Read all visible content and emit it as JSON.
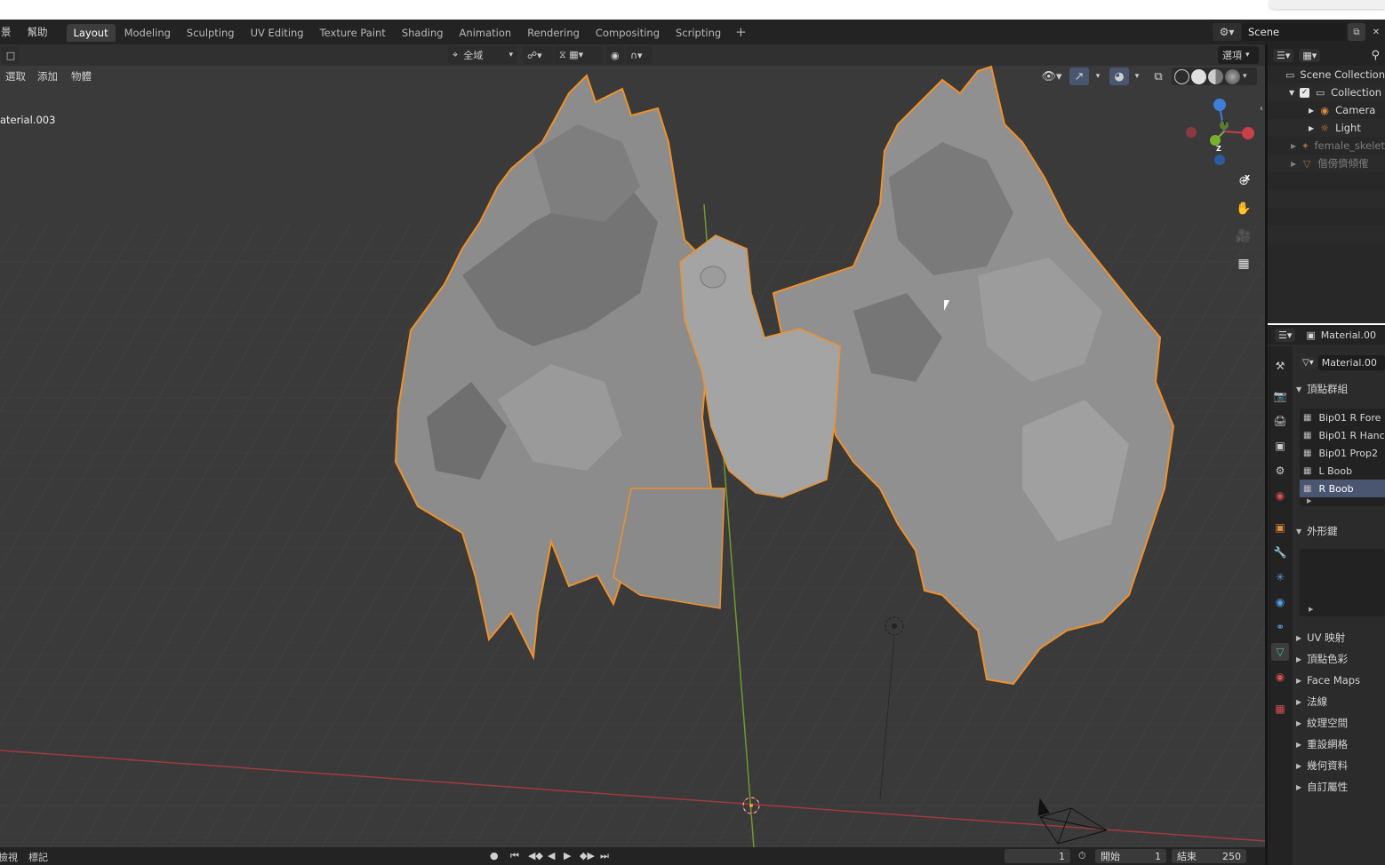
{
  "menu": {
    "partial_left": "景",
    "help": "幫助"
  },
  "workspaces": [
    "Layout",
    "Modeling",
    "Sculpting",
    "UV Editing",
    "Texture Paint",
    "Shading",
    "Animation",
    "Rendering",
    "Compositing",
    "Scripting"
  ],
  "workspace_add": "+",
  "scene": {
    "name": "Scene"
  },
  "viewport": {
    "orientation": "全域",
    "options": "選項",
    "menu_select": "選取",
    "menu_add": "添加",
    "menu_object": "物體",
    "object_label": "aterial.003",
    "gizmo_x": "X",
    "gizmo_y": "Y",
    "gizmo_z": "Z"
  },
  "timeline": {
    "view": "檢視",
    "marker": "標記",
    "current_frame": "1",
    "start_label": "開始",
    "start_value": "1",
    "end_label": "結束",
    "end_value": "250"
  },
  "outliner": {
    "items": [
      {
        "label": "Scene Collection",
        "icon": "scene-collection-icon"
      },
      {
        "label": "Collection",
        "icon": "collection-icon"
      },
      {
        "label": "Camera",
        "icon": "camera-icon"
      },
      {
        "label": "Light",
        "icon": "light-icon"
      },
      {
        "label": "female_skelet",
        "icon": "armature-icon"
      },
      {
        "label": "偕傍儕傾傕",
        "icon": "mesh-icon"
      }
    ]
  },
  "properties": {
    "object_name": "Material.00",
    "data_name": "Material.00",
    "vertex_groups_title": "頂點群組",
    "vertex_groups": [
      "Bip01 R Fore",
      "Bip01 R Hanc",
      "Bip01 Prop2",
      "L Boob",
      "R Boob"
    ],
    "shape_keys_title": "外形鍵",
    "collapsed_sections": [
      "UV 映射",
      "頂點色彩",
      "Face Maps",
      "法線",
      "紋理空間",
      "重設網格",
      "幾何資料",
      "自訂屬性"
    ]
  },
  "colors": {
    "selection_outline": "#f0902a",
    "axis_x": "#c84048",
    "axis_y": "#7ab030",
    "axis_z": "#3b7fd8",
    "accent_blue": "#4a5670"
  }
}
